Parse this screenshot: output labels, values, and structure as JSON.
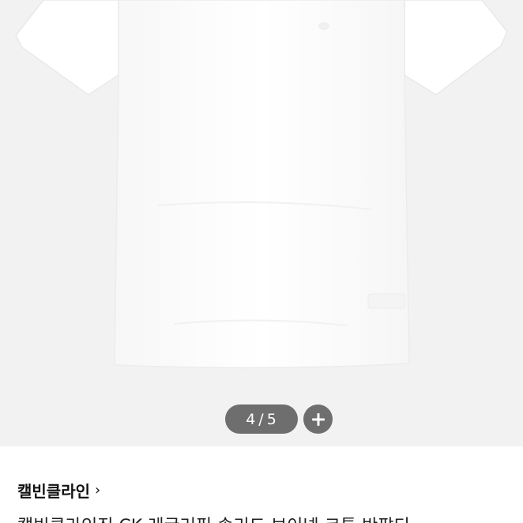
{
  "gallery": {
    "pager_current": "4",
    "pager_separator": "/",
    "pager_total": "5",
    "zoom_icon": "plus-icon",
    "colors": {
      "background": "#f2f2f2",
      "shirt": "#ffffff",
      "control": "#6e6e6e"
    }
  },
  "product": {
    "brand": "캘빈클라인",
    "brand_chevron": "›",
    "title": "캘빈클라인진 CK 레귤러핏 솔리드 브이넥 코튼 반팔티"
  }
}
